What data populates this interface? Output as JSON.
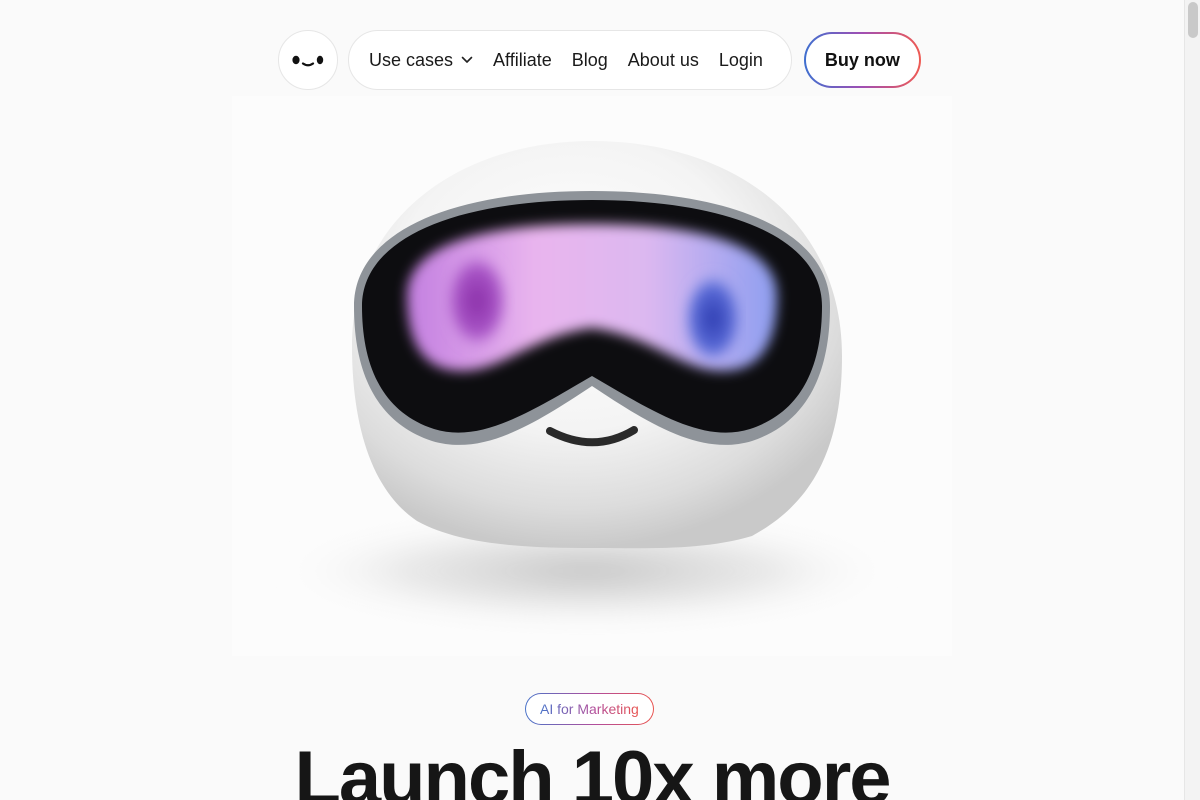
{
  "header": {
    "logo_icon": "robot-face-icon",
    "nav": [
      {
        "label": "Use cases",
        "has_dropdown": true
      },
      {
        "label": "Affiliate"
      },
      {
        "label": "Blog"
      },
      {
        "label": "About us"
      },
      {
        "label": "Login"
      }
    ],
    "buy_label": "Buy now"
  },
  "hero": {
    "image": "robot-with-vr-visor-illustration"
  },
  "badge": {
    "label": "AI for Marketing"
  },
  "headline": "Launch 10x more",
  "colors": {
    "gradient_start": "#3e6fcf",
    "gradient_mid": "#a14fb3",
    "gradient_end": "#ef5a52",
    "background": "#fafafa"
  }
}
